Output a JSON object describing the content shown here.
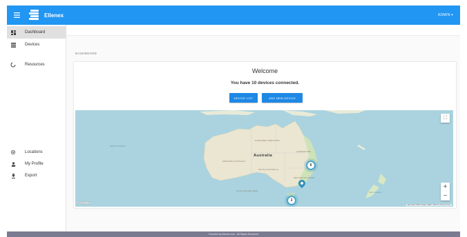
{
  "header": {
    "brand": "Ellenex",
    "user_label": "ADMIN ▾",
    "accent_color": "#2196f3"
  },
  "sidebar": {
    "items": [
      {
        "label": "Dashboard",
        "icon": "dashboard-icon"
      },
      {
        "label": "Devices",
        "icon": "list-icon"
      },
      {
        "label": "Resources",
        "icon": "loading-icon"
      },
      {
        "label": "Locations",
        "icon": "location-target-icon"
      },
      {
        "label": "My Profile",
        "icon": "person-icon"
      },
      {
        "label": "Export",
        "icon": "download-icon"
      }
    ],
    "active": "Dashboard"
  },
  "main": {
    "breadcrumb": "DASHBOARD",
    "welcome_title": "Welcome",
    "devices_message": "You have 10 devices connected.",
    "buttons": {
      "device_list": "DEVICE LIST",
      "add_new_device": "ADD NEW DEVICE"
    }
  },
  "map": {
    "country_label": "Australia",
    "clusters": [
      {
        "count": "6"
      },
      {
        "count": "3"
      }
    ],
    "zoom_in": "+",
    "zoom_out": "−",
    "fullscreen_icon": "⛶",
    "logo_text": "Google",
    "attribution": "Map data ©2020 Google, INEGI | 200 km | Terms of Use"
  },
  "footer": {
    "text": "Powered by ellenex.com - All Rights Reserved"
  }
}
